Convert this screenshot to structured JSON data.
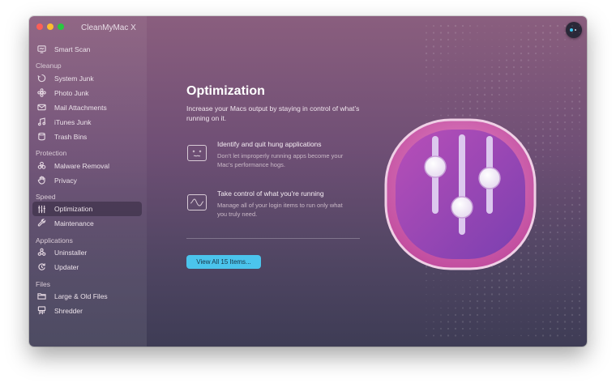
{
  "window": {
    "title": "CleanMyMac X"
  },
  "sidebar": {
    "top_items": [
      {
        "label": "Smart Scan",
        "icon": "monitor-icon"
      }
    ],
    "sections": [
      {
        "title": "Cleanup",
        "items": [
          {
            "label": "System Junk",
            "icon": "recycle-icon"
          },
          {
            "label": "Photo Junk",
            "icon": "flower-icon"
          },
          {
            "label": "Mail Attachments",
            "icon": "mail-icon"
          },
          {
            "label": "iTunes Junk",
            "icon": "music-note-icon"
          },
          {
            "label": "Trash Bins",
            "icon": "trash-icon"
          }
        ]
      },
      {
        "title": "Protection",
        "items": [
          {
            "label": "Malware Removal",
            "icon": "biohazard-icon"
          },
          {
            "label": "Privacy",
            "icon": "hand-icon"
          }
        ]
      },
      {
        "title": "Speed",
        "items": [
          {
            "label": "Optimization",
            "icon": "sliders-icon",
            "active": true
          },
          {
            "label": "Maintenance",
            "icon": "wrench-icon"
          }
        ]
      },
      {
        "title": "Applications",
        "items": [
          {
            "label": "Uninstaller",
            "icon": "uninstaller-icon"
          },
          {
            "label": "Updater",
            "icon": "updater-icon"
          }
        ]
      },
      {
        "title": "Files",
        "items": [
          {
            "label": "Large & Old Files",
            "icon": "folder-icon"
          },
          {
            "label": "Shredder",
            "icon": "shredder-icon"
          }
        ]
      }
    ]
  },
  "main": {
    "title": "Optimization",
    "description": "Increase your Macs output by staying in control of what’s running on it.",
    "features": [
      {
        "title": "Identify and quit hung applications",
        "description": "Don't let improperly running apps become your Mac's performance hogs.",
        "icon": "hung-app-icon"
      },
      {
        "title": "Take control of what you're running",
        "description": "Manage all of your login items to run only what you truly need.",
        "icon": "activity-graph-icon"
      }
    ],
    "cta_label": "View All 15 Items..."
  },
  "colors": {
    "accent": "#4bc4ec",
    "art_pink": "#c24d9f",
    "art_purple": "#7a3fb0"
  }
}
